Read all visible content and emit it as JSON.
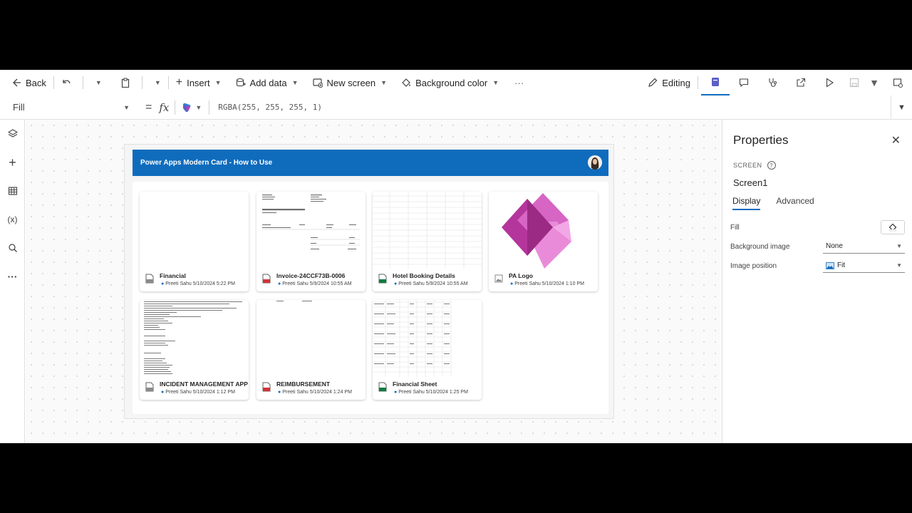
{
  "toolbar": {
    "back_label": "Back",
    "insert_label": "Insert",
    "add_data_label": "Add data",
    "new_screen_label": "New screen",
    "background_color_label": "Background color",
    "more_label": "···",
    "editing_label": "Editing"
  },
  "formula_bar": {
    "property": "Fill",
    "equals": "=",
    "fx": "fx",
    "formula": "RGBA(255, 255, 255, 1)"
  },
  "app_screen": {
    "header_title": "Power Apps Modern Card - How to Use",
    "cards": [
      {
        "title": "Financial",
        "meta": "Preeti Sahu 5/10/2024 5:22 PM",
        "file_type": "generic"
      },
      {
        "title": "Invoice-24CCF73B-0006",
        "meta": "Preeti Sahu 5/9/2024 10:55 AM",
        "file_type": "pdf"
      },
      {
        "title": "Hotel Booking Details",
        "meta": "Preeti Sahu 5/9/2024 10:55 AM",
        "file_type": "excel"
      },
      {
        "title": "PA Logo",
        "meta": "Preeti Sahu 5/10/2024 1:10 PM",
        "file_type": "image"
      },
      {
        "title": "INCIDENT MANAGEMENT APP",
        "meta": "Preeti Sahu 5/10/2024 1:12 PM",
        "file_type": "generic"
      },
      {
        "title": "REIMBURSEMENT",
        "meta": "Preeti Sahu 5/10/2024 1:24 PM",
        "file_type": "pdf"
      },
      {
        "title": "Financial Sheet",
        "meta": "Preeti Sahu 5/10/2024 1:25 PM",
        "file_type": "excel"
      }
    ]
  },
  "properties": {
    "title": "Properties",
    "kind": "SCREEN",
    "screen_name": "Screen1",
    "tabs": [
      "Display",
      "Advanced"
    ],
    "fill_label": "Fill",
    "background_image_label": "Background image",
    "background_image_value": "None",
    "image_position_label": "Image position",
    "image_position_value": "Fit"
  },
  "colors": {
    "header_blue": "#0f6cbd",
    "pdf_red": "#d13438",
    "excel_green": "#107c41",
    "logo_purple": "#b4359c"
  }
}
